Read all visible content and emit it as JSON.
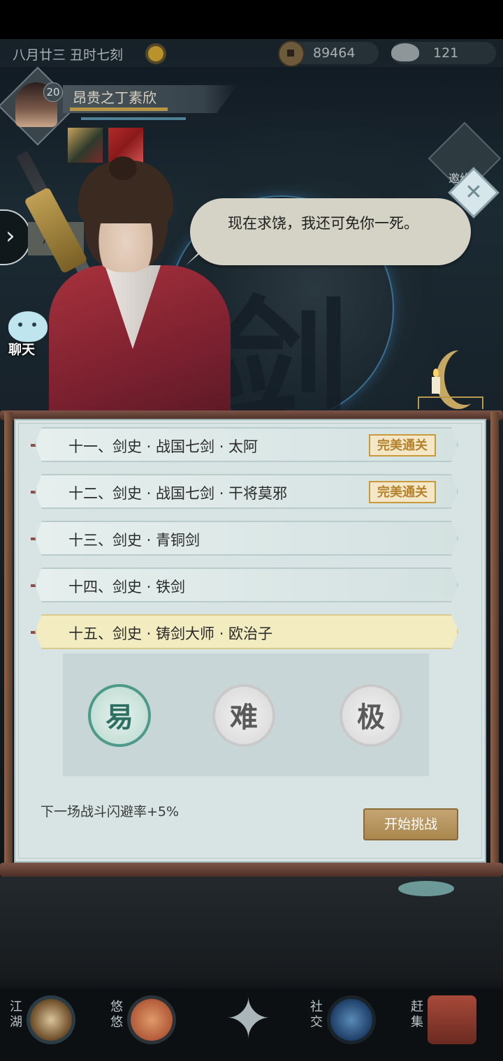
{
  "header": {
    "date": "八月廿三  丑时七刻",
    "copper": "89464",
    "silver": "121"
  },
  "player": {
    "level": "20",
    "name": "昂贵之丁素欣"
  },
  "side": {
    "invite": "邀约",
    "lake_tag": "湖",
    "chat": "聊天"
  },
  "dialogue": {
    "text": "现在求饶，我还可免你一死。"
  },
  "levels": [
    {
      "title": "十一、剑史 · 战国七剑 · 太阿",
      "badge": "完美通关"
    },
    {
      "title": "十二、剑史 · 战国七剑 · 干将莫邪",
      "badge": "完美通关"
    },
    {
      "title": "十三、剑史 · 青铜剑",
      "badge": ""
    },
    {
      "title": "十四、剑史 · 铁剑",
      "badge": ""
    },
    {
      "title": "十五、剑史 · 铸剑大师 · 欧治子",
      "badge": ""
    }
  ],
  "difficulty": {
    "easy": "易",
    "hard": "难",
    "extreme": "极"
  },
  "bonus_text": "下一场战斗闪避率+5%",
  "start_button": "开始挑战",
  "nav": {
    "jianghu": "江湖",
    "youyou": "悠悠",
    "shejiao": "社交",
    "ganji": "赶集"
  }
}
